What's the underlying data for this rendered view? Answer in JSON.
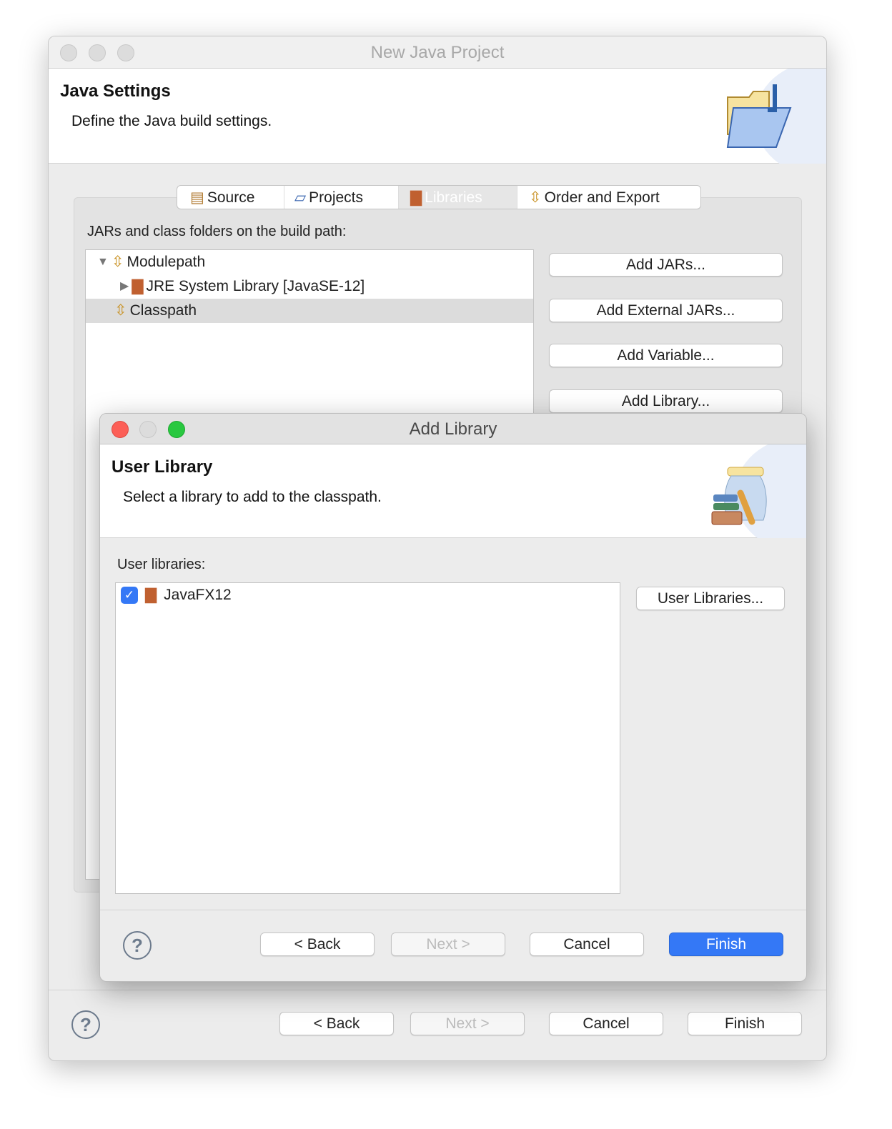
{
  "outer": {
    "title": "New Java Project",
    "header_title": "Java Settings",
    "header_desc": "Define the Java build settings.",
    "tabs": [
      {
        "label": "Source"
      },
      {
        "label": "Projects"
      },
      {
        "label": "Libraries"
      },
      {
        "label": "Order and Export"
      }
    ],
    "build_path_label": "JARs and class folders on the build path:",
    "tree": [
      {
        "label": "Modulepath"
      },
      {
        "label": "JRE System Library [JavaSE-12]"
      },
      {
        "label": "Classpath"
      }
    ],
    "side_buttons": [
      "Add JARs...",
      "Add External JARs...",
      "Add Variable...",
      "Add Library..."
    ],
    "footer": {
      "help": "?",
      "back": "< Back",
      "next": "Next >",
      "cancel": "Cancel",
      "finish": "Finish"
    }
  },
  "dialog": {
    "title": "Add Library",
    "header_title": "User Library",
    "header_desc": "Select a library to add to the classpath.",
    "list_label": "User libraries:",
    "libraries": [
      {
        "label": "JavaFX12",
        "checked": true
      }
    ],
    "user_libraries_button": "User Libraries...",
    "footer": {
      "help": "?",
      "back": "< Back",
      "next": "Next >",
      "cancel": "Cancel",
      "finish": "Finish"
    },
    "accent": "#3478f6"
  }
}
